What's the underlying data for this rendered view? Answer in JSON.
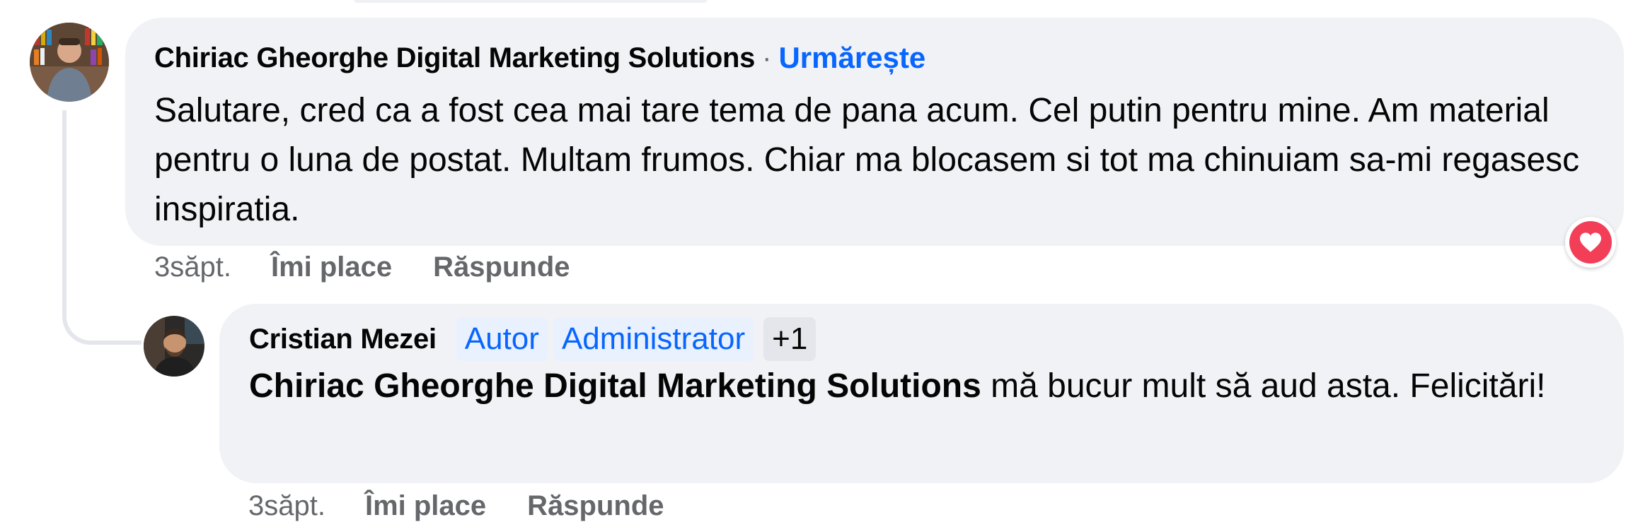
{
  "comments": [
    {
      "author": "Chiriac Gheorghe Digital Marketing Solutions",
      "separator": "·",
      "follow_label": "Urmărește",
      "text": "Salutare, cred ca a fost cea mai tare tema de pana acum. Cel putin pentru mine. Am material pentru o luna de postat. Multam frumos. Chiar ma blocasem si tot ma chinuiam sa-mi regasesc inspiratia.",
      "time": "3săpt.",
      "like_label": "Îmi place",
      "reply_label": "Răspunde",
      "reaction_icon": "heart-icon",
      "reaction_color": "#f33e58"
    },
    {
      "author": "Cristian Mezei",
      "badges": [
        "Autor",
        "Administrator",
        "+1"
      ],
      "mention": "Chiriac Gheorghe Digital Marketing Solutions",
      "text": " mă bucur mult să aud asta. Felicitări!",
      "time": "3săpt.",
      "like_label": "Îmi place",
      "reply_label": "Răspunde"
    }
  ],
  "colors": {
    "bubble_bg": "#f0f2f5",
    "link_blue": "#0866ff",
    "badge_bg": "#e9f1fe",
    "meta_grey": "#65676b"
  }
}
